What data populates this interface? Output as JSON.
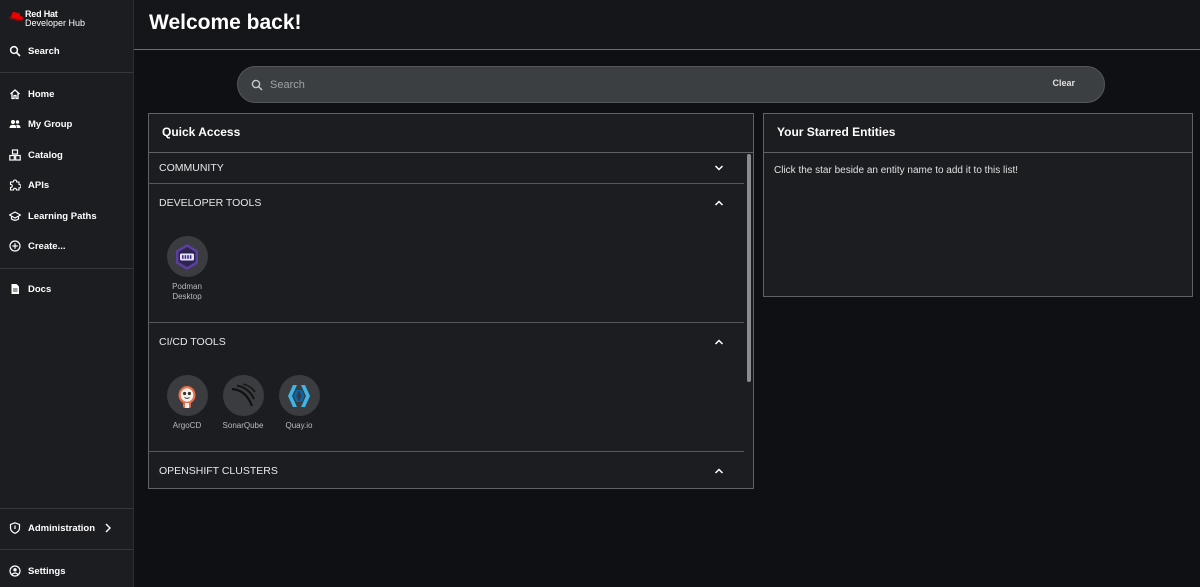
{
  "brand": {
    "name": "Red Hat",
    "product": "Developer Hub",
    "accent": "#ee0000"
  },
  "sidebar": {
    "search_label": "Search",
    "items": [
      {
        "label": "Home",
        "icon": "home-icon"
      },
      {
        "label": "My Group",
        "icon": "group-icon"
      },
      {
        "label": "Catalog",
        "icon": "catalog-icon"
      },
      {
        "label": "APIs",
        "icon": "puzzle-icon"
      },
      {
        "label": "Learning Paths",
        "icon": "school-icon"
      },
      {
        "label": "Create...",
        "icon": "add-circle-icon"
      }
    ],
    "docs_label": "Docs",
    "admin_label": "Administration",
    "settings_label": "Settings"
  },
  "header": {
    "title": "Welcome back!"
  },
  "search": {
    "placeholder": "Search",
    "value": "",
    "clear_label": "Clear"
  },
  "quick_access": {
    "title": "Quick Access",
    "sections": [
      {
        "label": "COMMUNITY",
        "expanded": false,
        "items": []
      },
      {
        "label": "DEVELOPER TOOLS",
        "expanded": true,
        "items": [
          {
            "label": "Podman Desktop",
            "line1": "Podman",
            "line2": "Desktop",
            "icon": "podman-icon"
          }
        ]
      },
      {
        "label": "CI/CD TOOLS",
        "expanded": true,
        "items": [
          {
            "label": "ArgoCD",
            "icon": "argocd-icon"
          },
          {
            "label": "SonarQube",
            "icon": "sonarqube-icon"
          },
          {
            "label": "Quay.io",
            "icon": "quay-icon"
          }
        ]
      },
      {
        "label": "OPENSHIFT CLUSTERS",
        "expanded": true,
        "items": []
      }
    ]
  },
  "starred": {
    "title": "Your Starred Entities",
    "empty_message": "Click the star beside an entity name to add it to this list!"
  }
}
